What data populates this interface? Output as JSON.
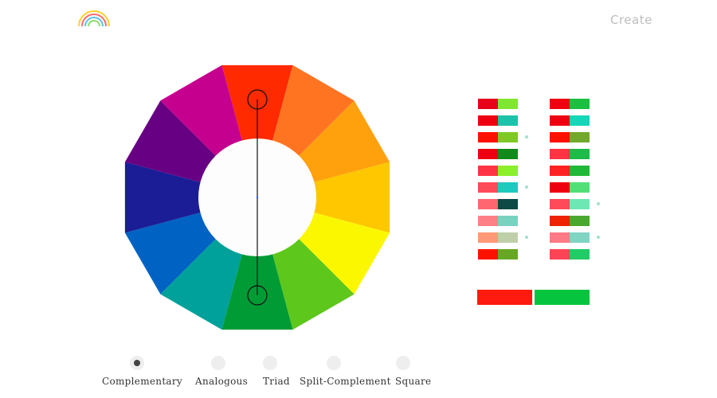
{
  "header": {
    "logo_icon": "rainbow-icon",
    "create_label": "Create"
  },
  "wheel": {
    "segments": [
      "#ff2a00",
      "#ff7421",
      "#ffa10d",
      "#ffc700",
      "#fbf700",
      "#5dc71c",
      "#009b35",
      "#00a19a",
      "#0063c4",
      "#1b1d97",
      "#670083",
      "#c5008f"
    ],
    "selected_indices": [
      0,
      6
    ]
  },
  "swatch_columns": [
    [
      {
        "a": "#e8001a",
        "b": "#80e632",
        "dot": false
      },
      {
        "a": "#ee0011",
        "b": "#1cc3aa",
        "dot": false
      },
      {
        "a": "#ff1100",
        "b": "#7fc926",
        "dot": true
      },
      {
        "a": "#ee0011",
        "b": "#128a1b",
        "dot": false
      },
      {
        "a": "#ff3344",
        "b": "#8af02c",
        "dot": false
      },
      {
        "a": "#ff4a5a",
        "b": "#1ccac0",
        "dot": true
      },
      {
        "a": "#ff6670",
        "b": "#0e4a45",
        "dot": false
      },
      {
        "a": "#ff7f86",
        "b": "#78d2c0",
        "dot": false
      },
      {
        "a": "#ff9976",
        "b": "#bfcfaa",
        "dot": true
      },
      {
        "a": "#ff1100",
        "b": "#66a825",
        "dot": false
      }
    ],
    [
      {
        "a": "#ee0011",
        "b": "#1bc040",
        "dot": false
      },
      {
        "a": "#ee0011",
        "b": "#15d6b8",
        "dot": false
      },
      {
        "a": "#ff1100",
        "b": "#72a82c",
        "dot": false
      },
      {
        "a": "#ff3344",
        "b": "#1dbb48",
        "dot": false
      },
      {
        "a": "#ff2222",
        "b": "#20b838",
        "dot": false
      },
      {
        "a": "#ee0011",
        "b": "#52e076",
        "dot": false
      },
      {
        "a": "#ff4a5a",
        "b": "#6de8b5",
        "dot": true
      },
      {
        "a": "#ee2200",
        "b": "#4aa82e",
        "dot": false
      },
      {
        "a": "#ff7a86",
        "b": "#7fd4c2",
        "dot": true
      },
      {
        "a": "#ff4455",
        "b": "#1fcc66",
        "dot": false
      }
    ]
  ],
  "selected_pair": [
    "#ff1a0f",
    "#06c43e"
  ],
  "modes": [
    {
      "label": "Complementary",
      "active": true
    },
    {
      "label": "Analogous",
      "active": false
    },
    {
      "label": "Triad",
      "active": false
    },
    {
      "label": "Split-Complement",
      "active": false
    },
    {
      "label": "Square",
      "active": false
    }
  ]
}
